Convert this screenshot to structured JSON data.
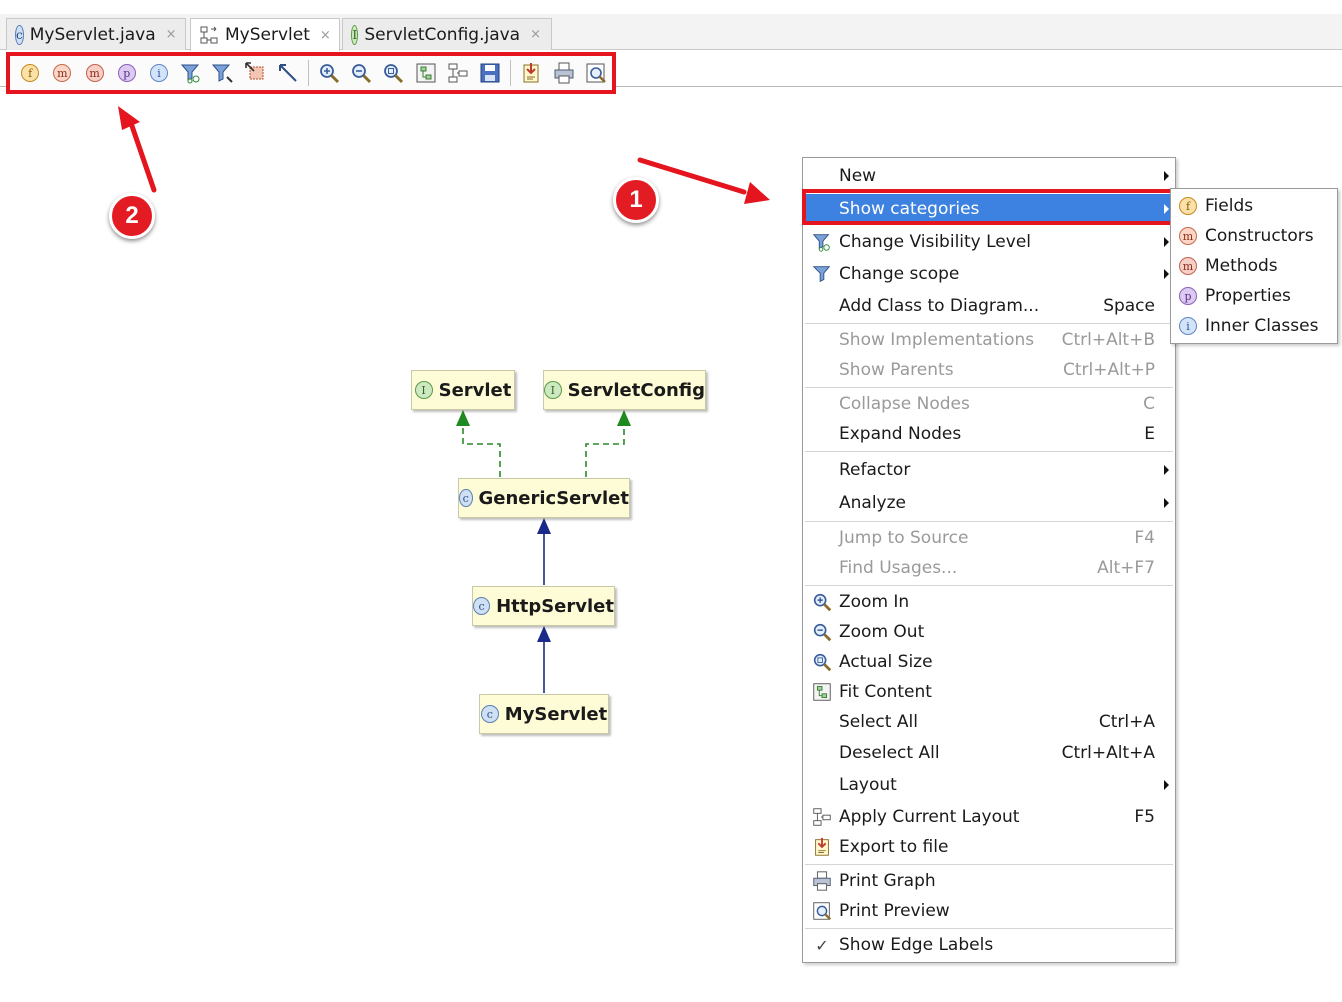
{
  "tabs": [
    {
      "label": "MyServlet.java",
      "icon": "class-icon",
      "close": "×",
      "active": false
    },
    {
      "label": "MyServlet",
      "icon": "diagram-icon",
      "close": "×",
      "active": true
    },
    {
      "label": "ServletConfig.java",
      "icon": "interface-icon",
      "close": "×",
      "active": false
    }
  ],
  "toolbar": {
    "category_buttons": [
      "f",
      "m",
      "m",
      "p",
      "i"
    ]
  },
  "badges": {
    "one": "1",
    "two": "2"
  },
  "diagram": {
    "nodes": [
      {
        "name": "Servlet",
        "icon_letter": "I"
      },
      {
        "name": "ServletConfig",
        "icon_letter": "I"
      },
      {
        "name": "GenericServlet",
        "icon_letter": "c"
      },
      {
        "name": "HttpServlet",
        "icon_letter": "c"
      },
      {
        "name": "MyServlet",
        "icon_letter": "c"
      }
    ]
  },
  "menu": {
    "new": "New",
    "show_categories": "Show categories",
    "change_visibility": "Change Visibility Level",
    "change_scope": "Change scope",
    "add_class": "Add Class to Diagram...",
    "add_class_sc": "Space",
    "show_impl": "Show Implementations",
    "show_impl_sc": "Ctrl+Alt+B",
    "show_parents": "Show Parents",
    "show_parents_sc": "Ctrl+Alt+P",
    "collapse": "Collapse Nodes",
    "collapse_sc": "C",
    "expand": "Expand Nodes",
    "expand_sc": "E",
    "refactor": "Refactor",
    "analyze": "Analyze",
    "jump": "Jump to Source",
    "jump_sc": "F4",
    "find_usages": "Find Usages...",
    "find_usages_sc": "Alt+F7",
    "zoom_in": "Zoom In",
    "zoom_out": "Zoom Out",
    "actual_size": "Actual Size",
    "fit_content": "Fit Content",
    "select_all": "Select All",
    "select_all_sc": "Ctrl+A",
    "deselect_all": "Deselect All",
    "deselect_all_sc": "Ctrl+Alt+A",
    "layout": "Layout",
    "apply_layout": "Apply Current Layout",
    "apply_layout_sc": "F5",
    "export": "Export to file",
    "print_graph": "Print Graph",
    "print_preview": "Print Preview",
    "show_edge_labels": "Show Edge Labels",
    "check_mark": "✓"
  },
  "submenu": {
    "fields": "Fields",
    "constructors": "Constructors",
    "methods": "Methods",
    "properties": "Properties",
    "inner_classes": "Inner Classes"
  },
  "colors": {
    "highlight_red": "#e4151f",
    "menu_selection": "#3d82e0",
    "node_fill": "#fdfcd6",
    "interface_arrow": "#1f8a1f",
    "class_arrow": "#1a2a8a"
  }
}
